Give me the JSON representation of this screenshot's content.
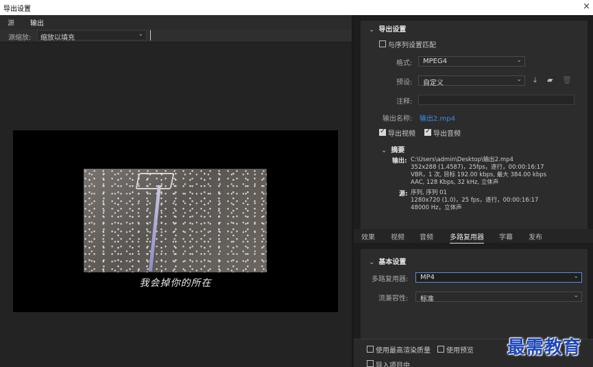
{
  "window": {
    "title": "导出设置",
    "close_glyph": "×"
  },
  "left": {
    "tabs": [
      "源",
      "输出"
    ],
    "scale_label": "源缩放:",
    "scale_value": "缩放以填充",
    "caption": "我会掉你的所在"
  },
  "export": {
    "section_title": "导出设置",
    "match_sequence": "与序列设置匹配",
    "format_label": "格式:",
    "format_value": "MPEG4",
    "preset_label": "预设:",
    "preset_value": "自定义",
    "comment_label": "注释:",
    "comment_value": "",
    "output_name_label": "输出名称:",
    "output_name_value": "输出2.mp4",
    "export_video": "导出视频",
    "export_audio": "导出音频",
    "summary_title": "摘要",
    "output_key": "输出:",
    "output_lines": [
      "C:\\Users\\admin\\Desktop\\输出2.mp4",
      "352x288 (1.4587)，25fps，逐行，00:00:16:17",
      "VBR，1 次, 目标 192.00 kbps, 最大 384.00 kbps",
      "AAC, 128 Kbps, 32  kHz, 立体声"
    ],
    "source_key": "源:",
    "source_lines": [
      "序列, 序列 01",
      "1280x720 (1.0)，25 fps，逐行，00:00:16:17",
      "48000 Hz，立体声"
    ]
  },
  "tabs": [
    "效果",
    "视频",
    "音频",
    "多路复用器",
    "字幕",
    "发布"
  ],
  "basic": {
    "section_title": "基本设置",
    "mux_label": "多路复用器:",
    "mux_value": "MP4",
    "stream_label": "流兼容性:",
    "stream_value": "标准"
  },
  "bottom": {
    "max_quality": "使用最高渲染质量",
    "use_preview": "使用预览",
    "import_project": "导入项目中"
  },
  "watermark": "最需教育"
}
